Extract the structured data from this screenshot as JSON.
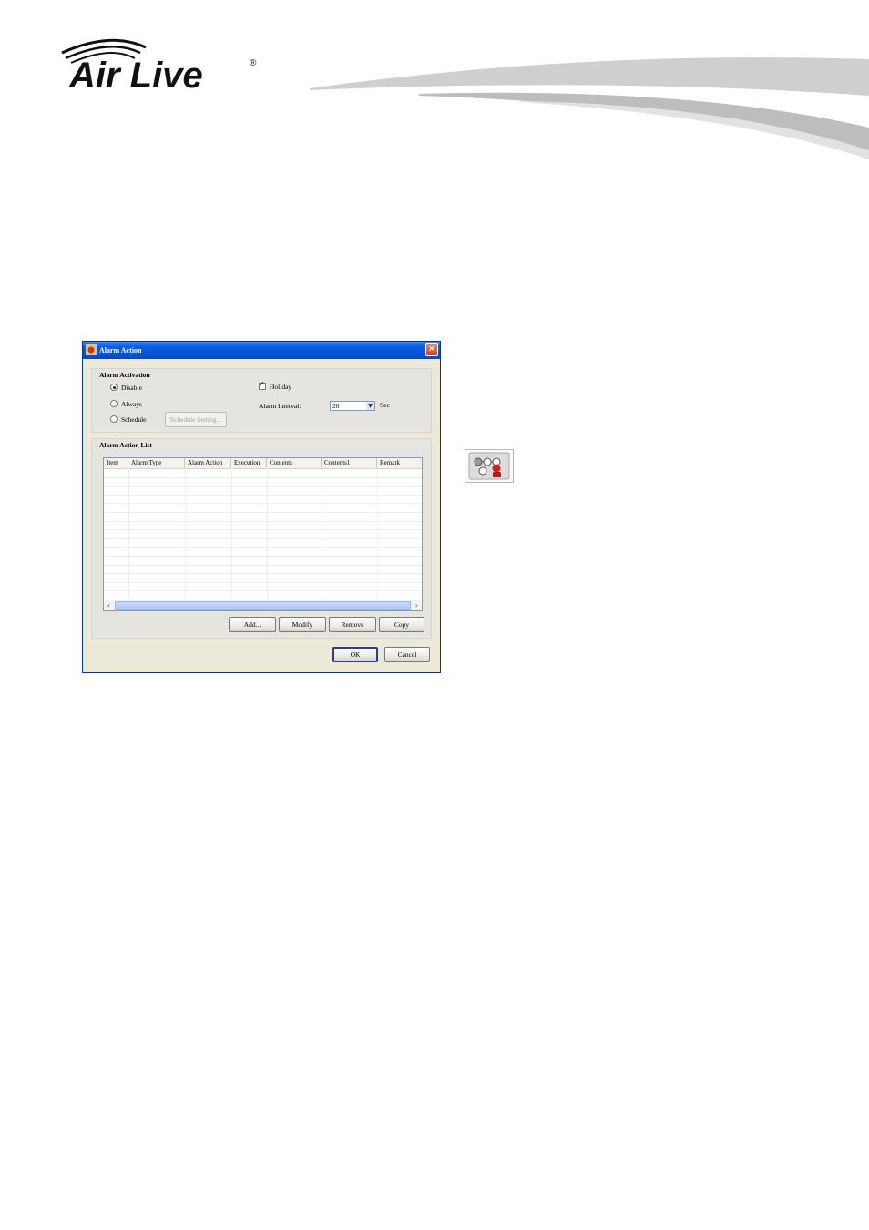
{
  "brand": {
    "name": "Air Live",
    "mark": "®"
  },
  "dialog": {
    "title": "Alarm Action",
    "close_symbol": "✕",
    "activation": {
      "heading": "Alarm Activation",
      "options": [
        {
          "label": "Disable",
          "selected": true
        },
        {
          "label": "Always",
          "selected": false
        },
        {
          "label": "Schedule",
          "selected": false
        }
      ],
      "schedule_button": "Schedule Setting...",
      "holiday": {
        "label": "Holiday",
        "checked": true
      },
      "interval": {
        "label": "Alarm Interval:",
        "value": "20",
        "unit": "Sec"
      }
    },
    "list": {
      "heading": "Alarm Action List",
      "columns": [
        "Item",
        "Alarm Type",
        "Alarm Action",
        "Execution",
        "Contents",
        "Contents1",
        "Remark"
      ],
      "rows": [],
      "buttons": {
        "add": "Add...",
        "modify": "Modify",
        "remove": "Remove",
        "copy": "Copy"
      }
    },
    "footer": {
      "ok": "OK",
      "cancel": "Cancel"
    }
  },
  "icons": {
    "side_icon": "alarm-action-icon",
    "title_icon": "app-icon"
  },
  "colors": {
    "titlebar": "#0454d8",
    "dialog_bg": "#ece9d8",
    "icon_red": "#d11e1e"
  }
}
